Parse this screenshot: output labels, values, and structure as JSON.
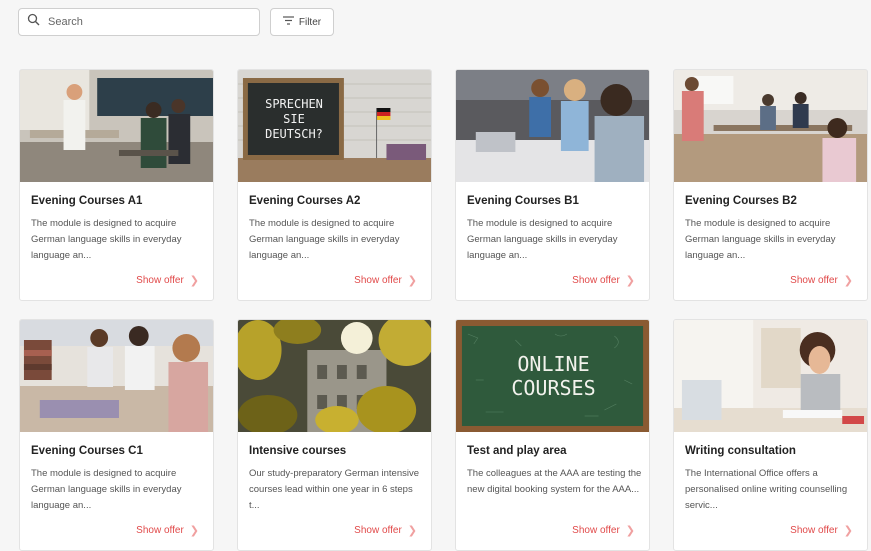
{
  "search": {
    "placeholder": "Search",
    "value": ""
  },
  "filter": {
    "label": "Filter"
  },
  "cards": [
    {
      "title": "Evening Courses A1",
      "description": "The module is designed to acquire German language skills in everyday language an...",
      "cta": "Show offer"
    },
    {
      "title": "Evening Courses A2",
      "description": "The module is designed to acquire German language skills in everyday language an...",
      "cta": "Show offer",
      "image_text": [
        "SPRECHEN",
        "SIE",
        "DEUTSCH?"
      ]
    },
    {
      "title": "Evening Courses B1",
      "description": "The module is designed to acquire German language skills in everyday language an...",
      "cta": "Show offer"
    },
    {
      "title": "Evening Courses B2",
      "description": "The module is designed to acquire German language skills in everyday language an...",
      "cta": "Show offer"
    },
    {
      "title": "Evening Courses C1",
      "description": "The module is designed to acquire German language skills in everyday language an...",
      "cta": "Show offer"
    },
    {
      "title": "Intensive courses",
      "description": "Our study-preparatory German intensive courses lead within one year in 6 steps t...",
      "cta": "Show offer"
    },
    {
      "title": "Test and play area",
      "description": "The colleagues at the AAA are testing the new digital booking system for the AAA...",
      "cta": "Show offer",
      "image_text": [
        "ONLINE",
        "COURSES"
      ]
    },
    {
      "title": "Writing consultation",
      "description": "The International Office offers a personalised online writing counselling servic...",
      "cta": "Show offer"
    }
  ],
  "colors": {
    "accent": "#e14a4a",
    "card_border": "#e3e3e3",
    "background": "#f6f6f6"
  }
}
